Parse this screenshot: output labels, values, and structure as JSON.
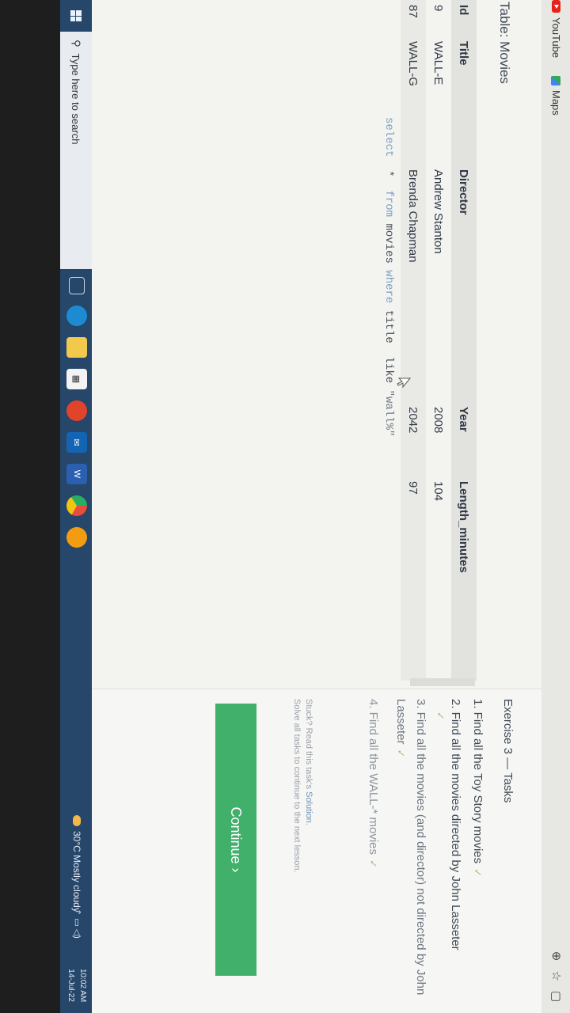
{
  "browser": {
    "bookmarks": [
      {
        "label": "YouTube",
        "icon": "youtube-icon"
      },
      {
        "label": "Maps",
        "icon": "maps-icon"
      }
    ],
    "toolbar_icons": [
      "zoom-icon",
      "star-icon",
      "extension-icon"
    ]
  },
  "table": {
    "title": "Table: Movies",
    "columns": [
      "Id",
      "Title",
      "Director",
      "Year",
      "Length_minutes"
    ],
    "rows": [
      [
        "9",
        "WALL-E",
        "Andrew Stanton",
        "2008",
        "104"
      ],
      [
        "87",
        "WALL-G",
        "Brenda Chapman",
        "2042",
        "97"
      ]
    ]
  },
  "editor": {
    "tokens": {
      "select": "select",
      "star": "*",
      "from": "from",
      "table": "movies",
      "where": "where",
      "column": "title",
      "like": "like",
      "pattern": "\"wall%\""
    }
  },
  "tasks": {
    "title": "Exercise 3 — Tasks",
    "items": [
      {
        "text": "1. Find all the Toy Story movies",
        "done": true
      },
      {
        "text": "2. Find all the movies directed by John Lasseter",
        "done": true
      },
      {
        "text": "3. Find all the movies (and director) not directed by John Lasseter",
        "done": true
      },
      {
        "text": "4. Find all the WALL-* movies",
        "done": true
      }
    ],
    "check": "✓",
    "stuck_prefix": "Stuck? Read this task's ",
    "solution_link": "Solution",
    "stuck_suffix": ".",
    "solve_hint": "Solve all tasks to continue to the next lesson.",
    "continue_label": "Continue ›"
  },
  "taskbar": {
    "search_placeholder": "Type here to search",
    "weather": "30°C  Mostly cloudy",
    "tray": "⌃  ▭  ◁)",
    "time": "10:02 AM",
    "date": "14-Jul-22"
  }
}
